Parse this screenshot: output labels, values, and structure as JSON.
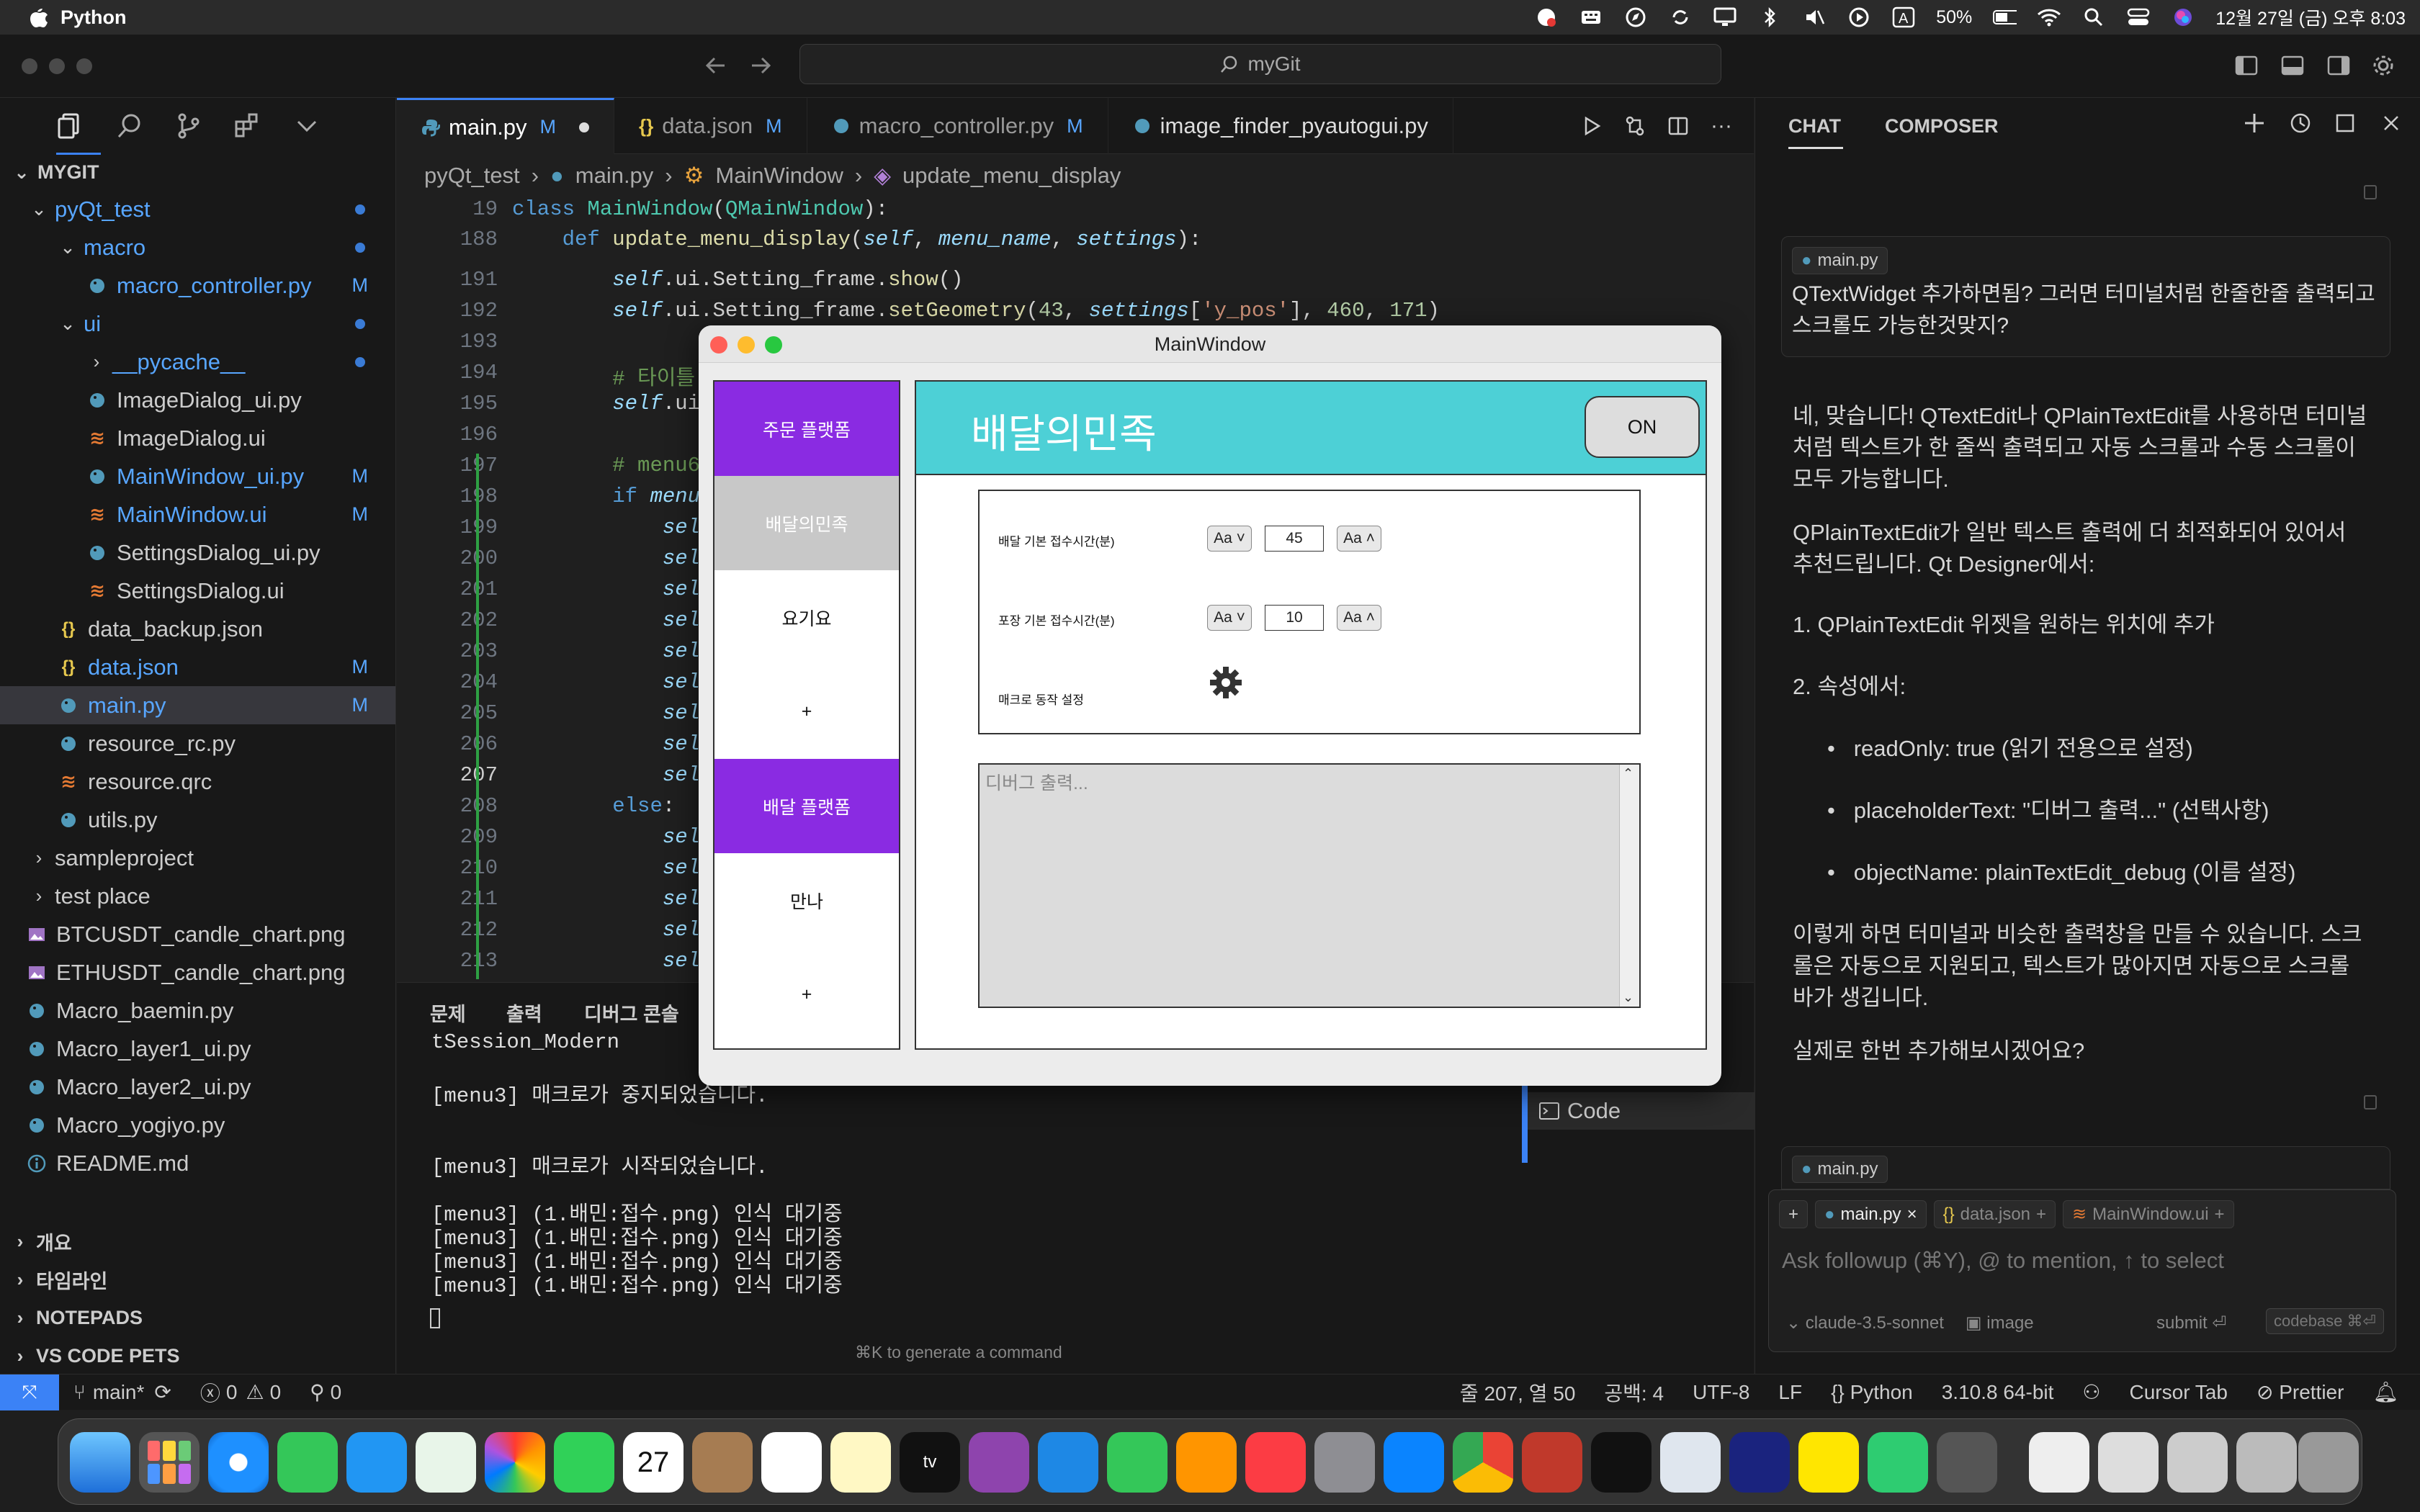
{
  "menubar": {
    "app": "Python",
    "battery": "50%",
    "clock": "12월 27일 (금) 오후 8:03"
  },
  "window": {
    "command_center": "myGit"
  },
  "explorer": {
    "title": "MYGIT",
    "items": [
      {
        "label": "pyQt_test",
        "depth": 0,
        "type": "folder-open",
        "dot": true,
        "mod": true
      },
      {
        "label": "macro",
        "depth": 1,
        "type": "folder-open",
        "dot": true,
        "mod": true
      },
      {
        "label": "macro_controller.py",
        "depth": 2,
        "type": "py",
        "badge": "M",
        "mod": true
      },
      {
        "label": "ui",
        "depth": 1,
        "type": "folder-open",
        "dot": true,
        "mod": true
      },
      {
        "label": "__pycache__",
        "depth": 2,
        "type": "folder-closed",
        "dot": true,
        "mod": true
      },
      {
        "label": "ImageDialog_ui.py",
        "depth": 2,
        "type": "py"
      },
      {
        "label": "ImageDialog.ui",
        "depth": 2,
        "type": "ui"
      },
      {
        "label": "MainWindow_ui.py",
        "depth": 2,
        "type": "py",
        "badge": "M",
        "mod": true
      },
      {
        "label": "MainWindow.ui",
        "depth": 2,
        "type": "ui",
        "badge": "M",
        "mod": true
      },
      {
        "label": "SettingsDialog_ui.py",
        "depth": 2,
        "type": "py"
      },
      {
        "label": "SettingsDialog.ui",
        "depth": 2,
        "type": "ui"
      },
      {
        "label": "data_backup.json",
        "depth": 1,
        "type": "json"
      },
      {
        "label": "data.json",
        "depth": 1,
        "type": "json",
        "badge": "M",
        "mod": true
      },
      {
        "label": "main.py",
        "depth": 1,
        "type": "py",
        "badge": "M",
        "mod": true,
        "selected": true
      },
      {
        "label": "resource_rc.py",
        "depth": 1,
        "type": "py"
      },
      {
        "label": "resource.qrc",
        "depth": 1,
        "type": "ui"
      },
      {
        "label": "utils.py",
        "depth": 1,
        "type": "py"
      },
      {
        "label": "sampleproject",
        "depth": 0,
        "type": "folder-closed"
      },
      {
        "label": "test place",
        "depth": 0,
        "type": "folder-closed"
      },
      {
        "label": "BTCUSDT_candle_chart.png",
        "depth": -1,
        "type": "img"
      },
      {
        "label": "ETHUSDT_candle_chart.png",
        "depth": -1,
        "type": "img"
      },
      {
        "label": "Macro_baemin.py",
        "depth": -1,
        "type": "py"
      },
      {
        "label": "Macro_layer1_ui.py",
        "depth": -1,
        "type": "py"
      },
      {
        "label": "Macro_layer2_ui.py",
        "depth": -1,
        "type": "py"
      },
      {
        "label": "Macro_yogiyo.py",
        "depth": -1,
        "type": "py"
      },
      {
        "label": "README.md",
        "depth": -1,
        "type": "info"
      }
    ],
    "sections": [
      "개요",
      "타임라인",
      "NOTEPADS",
      "VS CODE PETS"
    ]
  },
  "tabs": [
    {
      "label": "main.py",
      "badge": "M",
      "type": "py",
      "active": true
    },
    {
      "label": "data.json",
      "badge": "M",
      "type": "json"
    },
    {
      "label": "macro_controller.py",
      "badge": "M",
      "type": "py"
    },
    {
      "label": "image_finder_pyautogui.py",
      "badge": "",
      "type": "py"
    }
  ],
  "breadcrumb": {
    "folder": "pyQt_test",
    "file": "main.py",
    "class": "MainWindow",
    "method": "update_menu_display"
  },
  "editor": {
    "line_numbers": [
      "19",
      "188",
      "191",
      "192",
      "193",
      "194",
      "195",
      "196",
      "197",
      "198",
      "199",
      "200",
      "201",
      "202",
      "203",
      "204",
      "205",
      "206",
      "207",
      "208",
      "209",
      "210",
      "211",
      "212",
      "213"
    ],
    "current_line": "207"
  },
  "panel": {
    "tabs": [
      "문제",
      "출력",
      "디버그 콘솔"
    ],
    "terminal_lines": [
      "tSession_Modern",
      "",
      "[menu3] 매크로가 중지되었습니다.",
      "",
      "",
      "[menu3] 매크로가 시작되었습니다.",
      "",
      "[menu3] (1.배민:접수.png) 인식 대기중",
      "[menu3] (1.배민:접수.png) 인식 대기중",
      "[menu3] (1.배민:접수.png) 인식 대기중",
      "[menu3] (1.배민:접수.png) 인식 대기중"
    ],
    "hint": "⌘K to generate a command",
    "code_label": "Code"
  },
  "chat": {
    "tabs": [
      "CHAT",
      "COMPOSER"
    ],
    "user_file": "main.py",
    "user_message": "QTextWidget 추가하면됨? 그러면 터미널처럼 한줄한줄 출력되고 스크롤도 가능한것맞지?",
    "assistant": {
      "p1": "네, 맞습니다! QTextEdit나 QPlainTextEdit를 사용하면 터미널처럼 텍스트가 한 줄씩 출력되고 자동 스크롤과 수동 스크롤이 모두 가능합니다.",
      "p2": "QPlainTextEdit가 일반 텍스트 출력에 더 최적화되어 있어서 추천드립니다. Qt Designer에서:",
      "step1": "1. QPlainTextEdit 위젯을 원하는 위치에 추가",
      "step2": "2. 속성에서:",
      "bullets": [
        "readOnly: true (읽기 전용으로 설정)",
        "placeholderText: \"디버그 출력...\" (선택사항)",
        "objectName: plainTextEdit_debug (이름 설정)"
      ],
      "p3": "이렇게 하면 터미널과 비슷한 출력창을 만들 수 있습니다. 스크롤은 자동으로 지원되고, 텍스트가 많아지면 자동으로 스크롤바가 생깁니다.",
      "p4": "실제로 한번 추가해보시겠어요?"
    },
    "composer": {
      "file_chip": "main.py",
      "context_chips": [
        "main.py",
        "data.json",
        "MainWindow.ui"
      ],
      "placeholder": "Ask followup (⌘Y), @ to mention, ↑ to select",
      "model": "claude-3.5-sonnet",
      "image": "image",
      "submit": "submit ⏎",
      "codebase": "codebase ⌘⏎"
    }
  },
  "statusbar": {
    "branch": "main*",
    "errors": "0",
    "warnings": "0",
    "ports": "0",
    "position": "줄 207, 열 50",
    "spaces": "공백: 4",
    "encoding": "UTF-8",
    "eol": "LF",
    "language": "Python",
    "interpreter": "3.10.8 64-bit",
    "cursor_tab": "Cursor Tab",
    "prettier": "Prettier"
  },
  "qt": {
    "title": "MainWindow",
    "menu": [
      "주문 플랫폼",
      "배달의민족",
      "요기요",
      "+",
      "배달 플랫폼",
      "만나",
      "+"
    ],
    "header_title": "배달의민족",
    "on_button": "ON",
    "settings": [
      {
        "label": "배달 기본 접수시간(분)",
        "value": "45"
      },
      {
        "label": "포장 기본 접수시간(분)",
        "value": "10"
      }
    ],
    "macro_label": "매크로 동작 설정",
    "aa_down": "Aa ˅",
    "aa_up": "Aa ˄",
    "debug_placeholder": "디버그 출력..."
  },
  "colors": {
    "accent_blue": "#3b82f6",
    "purple": "#8a2be2",
    "teal": "#4dd0d6",
    "modified": "#58a6ff"
  }
}
